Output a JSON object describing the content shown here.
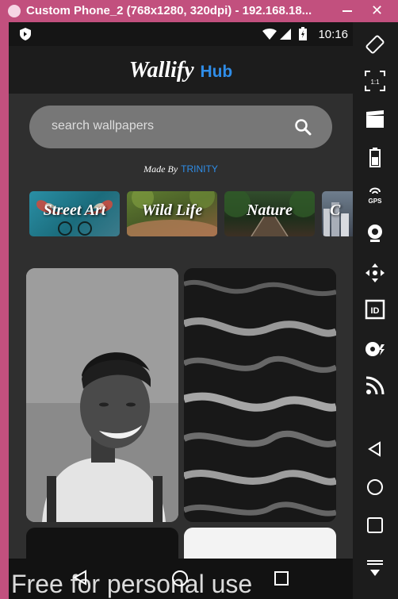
{
  "window": {
    "title": "Custom Phone_2 (768x1280, 320dpi) - 192.168.18..."
  },
  "status_bar": {
    "time": "10:16"
  },
  "app": {
    "brand_main": "Wallify",
    "brand_accent": "Hub"
  },
  "search": {
    "placeholder": "search wallpapers"
  },
  "credit": {
    "prefix": "Made By",
    "name": "TRINITY"
  },
  "categories": [
    {
      "label": "Street Art"
    },
    {
      "label": "Wild Life"
    },
    {
      "label": "Nature"
    },
    {
      "label": "C"
    }
  ],
  "watermark": "Free for personal use",
  "colors": {
    "accent": "#2f8de8",
    "background": "#2f2f2f",
    "search_bg": "#777777",
    "window_frame": "#c2507e"
  },
  "toolbar_icons": [
    "rotate-icon",
    "scale-icon",
    "camera-clip-icon",
    "battery-icon",
    "gps-icon",
    "webcam-icon",
    "move-icon",
    "id-icon",
    "disk-icon",
    "rss-icon",
    "back-icon",
    "home-icon",
    "overview-icon",
    "more-icon"
  ]
}
